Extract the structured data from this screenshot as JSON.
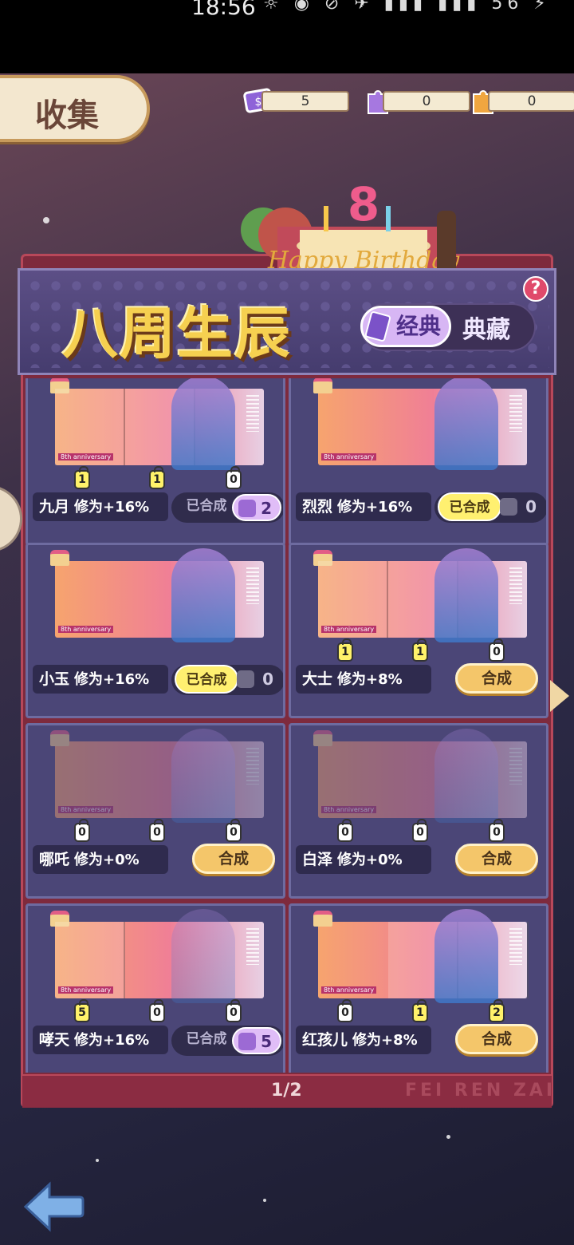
{
  "statusbar": {
    "time": "18:56",
    "icons": "☼ ◉ ⊘ ✈ ▮▮▮ ▮▮▮ 56 ⚡"
  },
  "header": {
    "title": "收集",
    "resources": [
      {
        "icon": "ticket-icon",
        "value": "5"
      },
      {
        "icon": "purple-puzzle-icon",
        "value": "0"
      },
      {
        "icon": "orange-puzzle-icon",
        "value": "0"
      }
    ]
  },
  "banner": {
    "title": "八周生辰",
    "tab_active": "经典",
    "tab_idle": "典藏",
    "help": "?",
    "cake_number": "8",
    "cake_text": "Happy Birthday"
  },
  "art_tag": "8th anniversary",
  "cards": [
    {
      "name": "九月",
      "bonus": "修为+16%",
      "counters": [
        "1",
        "1",
        "0"
      ],
      "counter_on": [
        true,
        true,
        false
      ],
      "state": "done-dark",
      "done_label": "已合成",
      "chip": "2",
      "chip_style": "purple"
    },
    {
      "name": "烈烈",
      "bonus": "修为+16%",
      "counters": [],
      "counter_on": [],
      "state": "done-yellow",
      "done_label": "已合成",
      "chip": "0",
      "chip_style": "grey"
    },
    {
      "name": "小玉",
      "bonus": "修为+16%",
      "counters": [],
      "counter_on": [],
      "state": "done-yellow",
      "done_label": "已合成",
      "chip": "0",
      "chip_style": "grey"
    },
    {
      "name": "大士",
      "bonus": "修为+8%",
      "counters": [
        "1",
        "1",
        "0"
      ],
      "counter_on": [
        true,
        true,
        false
      ],
      "state": "synth",
      "btn": "合成"
    },
    {
      "name": "哪吒",
      "bonus": "修为+0%",
      "counters": [
        "0",
        "0",
        "0"
      ],
      "counter_on": [
        false,
        false,
        false
      ],
      "state": "synth",
      "btn": "合成"
    },
    {
      "name": "白泽",
      "bonus": "修为+0%",
      "counters": [
        "0",
        "0",
        "0"
      ],
      "counter_on": [
        false,
        false,
        false
      ],
      "state": "synth",
      "btn": "合成"
    },
    {
      "name": "哮天",
      "bonus": "修为+16%",
      "counters": [
        "5",
        "0",
        "0"
      ],
      "counter_on": [
        true,
        false,
        false
      ],
      "state": "done-dark",
      "done_label": "已合成",
      "chip": "5",
      "chip_style": "purple"
    },
    {
      "name": "红孩儿",
      "bonus": "修为+8%",
      "counters": [
        "0",
        "1",
        "2"
      ],
      "counter_on": [
        false,
        true,
        true
      ],
      "state": "synth",
      "btn": "合成"
    }
  ],
  "footer": {
    "page": "1/2",
    "brand": "FEI REN ZAI"
  },
  "colors": {
    "accent": "#f6d050",
    "board": "#7e2a3d",
    "card": "#4b4677",
    "button": "#f4c66a",
    "chip_purple": "#e0bdf7"
  }
}
